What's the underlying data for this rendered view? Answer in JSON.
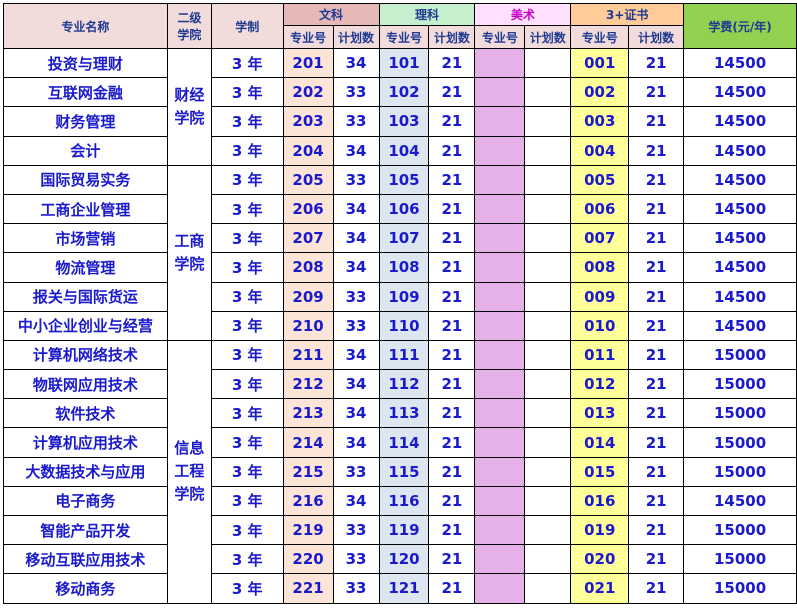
{
  "headers": {
    "major_name": "专业名称",
    "college": [
      "二级",
      "学院"
    ],
    "duration": "学制",
    "wen": "文科",
    "li": "理科",
    "mei": "美术",
    "sz": "3+证书",
    "fee": "学费(元/年)",
    "code": "专业号",
    "plan": "计划数"
  },
  "colleges": {
    "caijing": [
      "财经",
      "学院"
    ],
    "gongshang": [
      "工商",
      "学院"
    ],
    "xinxi": [
      "信息",
      "工程",
      "学院"
    ]
  },
  "rows": [
    {
      "name": "投资与理财",
      "dur": "3 年",
      "wen_code": "201",
      "wen_plan": "34",
      "li_code": "101",
      "li_plan": "21",
      "sz_code": "001",
      "sz_plan": "21",
      "fee": "14500"
    },
    {
      "name": "互联网金融",
      "dur": "3 年",
      "wen_code": "202",
      "wen_plan": "33",
      "li_code": "102",
      "li_plan": "21",
      "sz_code": "002",
      "sz_plan": "21",
      "fee": "14500"
    },
    {
      "name": "财务管理",
      "dur": "3 年",
      "wen_code": "203",
      "wen_plan": "33",
      "li_code": "103",
      "li_plan": "21",
      "sz_code": "003",
      "sz_plan": "21",
      "fee": "14500"
    },
    {
      "name": "会计",
      "dur": "3 年",
      "wen_code": "204",
      "wen_plan": "34",
      "li_code": "104",
      "li_plan": "21",
      "sz_code": "004",
      "sz_plan": "21",
      "fee": "14500"
    },
    {
      "name": "国际贸易实务",
      "dur": "3 年",
      "wen_code": "205",
      "wen_plan": "33",
      "li_code": "105",
      "li_plan": "21",
      "sz_code": "005",
      "sz_plan": "21",
      "fee": "14500"
    },
    {
      "name": "工商企业管理",
      "dur": "3 年",
      "wen_code": "206",
      "wen_plan": "34",
      "li_code": "106",
      "li_plan": "21",
      "sz_code": "006",
      "sz_plan": "21",
      "fee": "14500"
    },
    {
      "name": "市场营销",
      "dur": "3 年",
      "wen_code": "207",
      "wen_plan": "34",
      "li_code": "107",
      "li_plan": "21",
      "sz_code": "007",
      "sz_plan": "21",
      "fee": "14500"
    },
    {
      "name": "物流管理",
      "dur": "3 年",
      "wen_code": "208",
      "wen_plan": "34",
      "li_code": "108",
      "li_plan": "21",
      "sz_code": "008",
      "sz_plan": "21",
      "fee": "14500"
    },
    {
      "name": "报关与国际货运",
      "dur": "3 年",
      "wen_code": "209",
      "wen_plan": "33",
      "li_code": "109",
      "li_plan": "21",
      "sz_code": "009",
      "sz_plan": "21",
      "fee": "14500"
    },
    {
      "name": "中小企业创业与经营",
      "dur": "3 年",
      "wen_code": "210",
      "wen_plan": "33",
      "li_code": "110",
      "li_plan": "21",
      "sz_code": "010",
      "sz_plan": "21",
      "fee": "14500"
    },
    {
      "name": "计算机网络技术",
      "dur": "3 年",
      "wen_code": "211",
      "wen_plan": "34",
      "li_code": "111",
      "li_plan": "21",
      "sz_code": "011",
      "sz_plan": "21",
      "fee": "15000"
    },
    {
      "name": "物联网应用技术",
      "dur": "3 年",
      "wen_code": "212",
      "wen_plan": "34",
      "li_code": "112",
      "li_plan": "21",
      "sz_code": "012",
      "sz_plan": "21",
      "fee": "15000"
    },
    {
      "name": "软件技术",
      "dur": "3 年",
      "wen_code": "213",
      "wen_plan": "34",
      "li_code": "113",
      "li_plan": "21",
      "sz_code": "013",
      "sz_plan": "21",
      "fee": "15000"
    },
    {
      "name": "计算机应用技术",
      "dur": "3 年",
      "wen_code": "214",
      "wen_plan": "34",
      "li_code": "114",
      "li_plan": "21",
      "sz_code": "014",
      "sz_plan": "21",
      "fee": "15000"
    },
    {
      "name": "大数据技术与应用",
      "dur": "3 年",
      "wen_code": "215",
      "wen_plan": "33",
      "li_code": "115",
      "li_plan": "21",
      "sz_code": "015",
      "sz_plan": "21",
      "fee": "15000"
    },
    {
      "name": "电子商务",
      "dur": "3 年",
      "wen_code": "216",
      "wen_plan": "34",
      "li_code": "116",
      "li_plan": "21",
      "sz_code": "016",
      "sz_plan": "21",
      "fee": "14500"
    },
    {
      "name": "智能产品开发",
      "dur": "3 年",
      "wen_code": "219",
      "wen_plan": "33",
      "li_code": "119",
      "li_plan": "21",
      "sz_code": "019",
      "sz_plan": "21",
      "fee": "15000"
    },
    {
      "name": "移动互联应用技术",
      "dur": "3 年",
      "wen_code": "220",
      "wen_plan": "33",
      "li_code": "120",
      "li_plan": "21",
      "sz_code": "020",
      "sz_plan": "21",
      "fee": "15000"
    },
    {
      "name": "移动商务",
      "dur": "3 年",
      "wen_code": "221",
      "wen_plan": "33",
      "li_code": "121",
      "li_plan": "21",
      "sz_code": "021",
      "sz_plan": "21",
      "fee": "15000"
    }
  ]
}
